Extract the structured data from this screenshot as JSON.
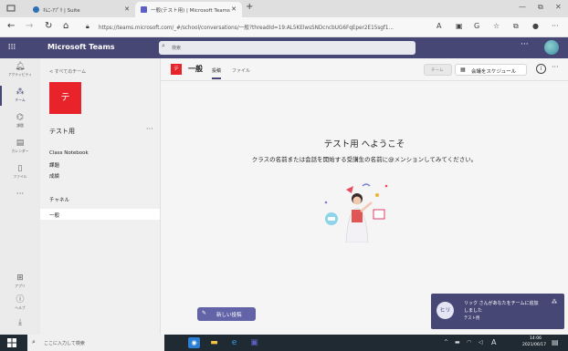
{
  "browser": {
    "tabs": [
      {
        "label": "ｷﾑﾆ-ｱﾌﾟﾘ | Suite",
        "active": false
      },
      {
        "label": "一般(テスト用) | Microsoft Teams",
        "active": true
      }
    ],
    "new_tab": "+",
    "url": "https://teams.microsoft.com/_#/school/conversations/一般?threadId=19:AL5KElwsSNDcncbUG6FqEper2E15sgf1...",
    "window_controls": {
      "minimize": "—",
      "restore": "⧉",
      "close": "✕"
    }
  },
  "teams_header": {
    "app_title": "Microsoft Teams",
    "search_placeholder": "検索",
    "more": "···"
  },
  "rail": [
    {
      "label": "アクティビティ",
      "icon": "bell-icon"
    },
    {
      "label": "チーム",
      "icon": "teams-icon",
      "active": true
    },
    {
      "label": "課題",
      "icon": "assignments-icon"
    },
    {
      "label": "カレンダー",
      "icon": "calendar-icon"
    },
    {
      "label": "ファイル",
      "icon": "files-icon"
    },
    {
      "label": "···",
      "icon": "more-icon"
    },
    {
      "label": "アプリ",
      "icon": "apps-icon"
    },
    {
      "label": "ヘルプ",
      "icon": "help-icon"
    },
    {
      "label": "",
      "icon": "download-icon"
    }
  ],
  "sidebar": {
    "back_link": "< すべてのチーム",
    "team_tile_letter": "テ",
    "team_name": "テスト用",
    "more": "···",
    "links": [
      "Class Notebook",
      "課題",
      "成績"
    ],
    "channels_heading": "チャネル",
    "channels": [
      "一般"
    ]
  },
  "channel": {
    "tile_letter": "テ",
    "title": "一般",
    "tabs": [
      "投稿",
      "ファイル"
    ],
    "team_pill": "チーム",
    "schedule_label": "会議をスケジュール",
    "info": "i",
    "more": "···"
  },
  "welcome": {
    "title": "テスト用 へようこそ",
    "subtitle": "クラスの名前または会話を開始する受講生の名前に@メンションしてみてください。"
  },
  "new_post": {
    "label": "新しい投稿"
  },
  "toast": {
    "avatar": "ヒリ",
    "line1": "リック さんがあなたをチームに追加",
    "line2": "しました",
    "line3": "テスト用"
  },
  "taskbar": {
    "search_placeholder": "ここに入力して検索",
    "time": "14:06",
    "date": "2021/06/17"
  },
  "colors": {
    "teams_purple": "#464775",
    "button_purple": "#6264a7",
    "team_red": "#e8232a",
    "taskbar": "#1f2a33"
  }
}
